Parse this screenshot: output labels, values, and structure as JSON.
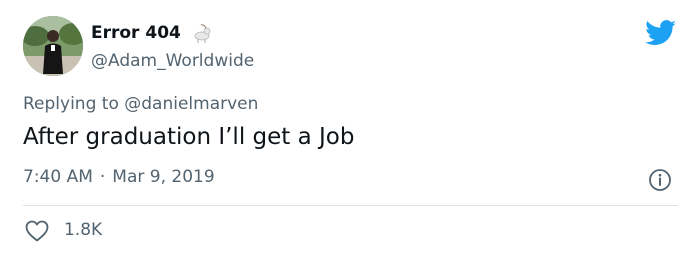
{
  "author": {
    "name": "Error 404",
    "handle": "@Adam_Worldwide",
    "emoji_icon": "goat-icon"
  },
  "reply": {
    "prefix": "Replying to ",
    "mention": "@danielmarven"
  },
  "tweet": {
    "text": "After graduation I’ll get a Job"
  },
  "meta": {
    "time": "7:40 AM",
    "separator": "·",
    "date": "Mar 9, 2019"
  },
  "stats": {
    "likes": "1.8K"
  },
  "colors": {
    "brand": "#1da1f2",
    "text": "#0f1419",
    "secondary": "#536471",
    "divider": "#dbe1e6"
  }
}
